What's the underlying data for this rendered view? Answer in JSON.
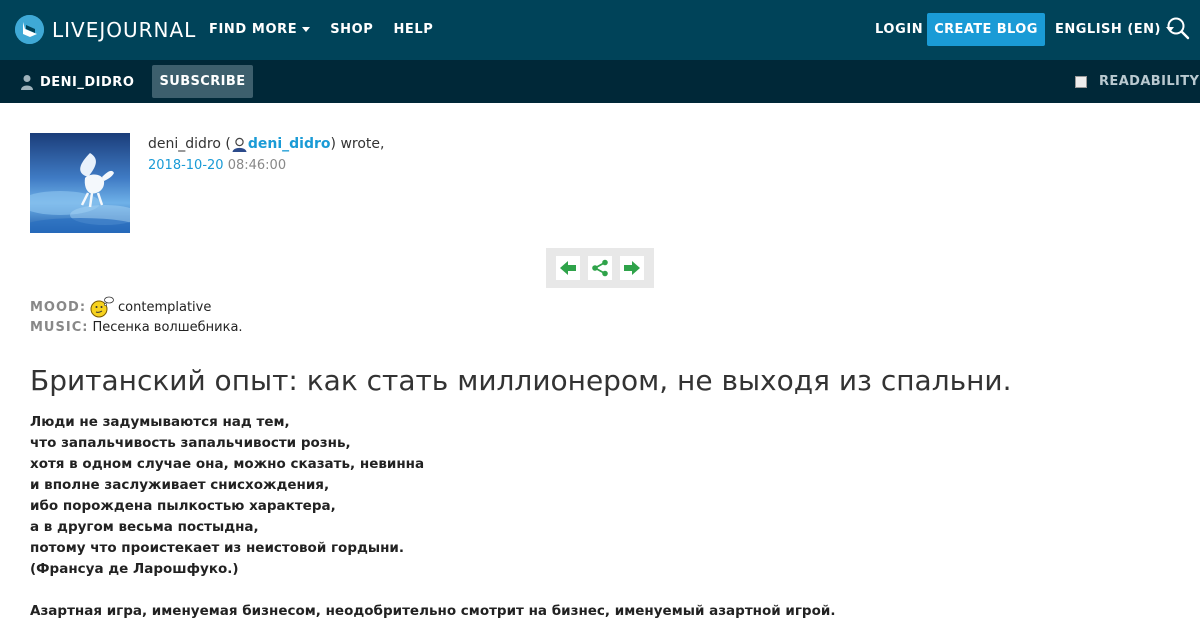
{
  "header": {
    "logo_text": "LIVEJOURNAL",
    "nav": [
      {
        "label": "FIND MORE",
        "has_dropdown": true
      },
      {
        "label": "SHOP",
        "has_dropdown": false
      },
      {
        "label": "HELP",
        "has_dropdown": false
      }
    ],
    "login_label": "LOGIN",
    "create_blog_label": "CREATE BLOG",
    "language_label": "ENGLISH (EN)",
    "search_icon": "search-icon"
  },
  "subheader": {
    "username": "DENI_DIDRO",
    "subscribe_label": "SUBSCRIBE",
    "readability_label": "READABILITY"
  },
  "entry": {
    "author_name": "deni_didro",
    "author_link": "deni_didro",
    "wrote": ") wrote,",
    "open_paren": " (",
    "date": "2018-10-20",
    "time": "08:46:00",
    "mood_label": "MOOD:",
    "mood_value": "contemplative",
    "music_label": "MUSIC:",
    "music_value": "Песенка волшебника.",
    "title": "Британский опыт: как стать миллионером, не выходя из спальни.",
    "body_lines": [
      "Люди не задумываются над тем,",
      "что запальчивость запальчивости рознь,",
      "хотя в одном случае она, можно сказать, невинна",
      "и вполне заслуживает снисхождения,",
      "ибо порождена пылкостью характера,",
      "а в другом весьма постыдна,",
      "потому что проистекает из неистовой гордыни.",
      "(Франсуа де Ларошфуко.)"
    ],
    "body_paragraph_2": "Азартная игра, именуемая бизнесом, неодобрительно смотрит на бизнес, именуемый азартной игрой."
  },
  "colors": {
    "header_bg": "#004359",
    "subheader_bg": "#002838",
    "accent": "#1a9bd6"
  }
}
